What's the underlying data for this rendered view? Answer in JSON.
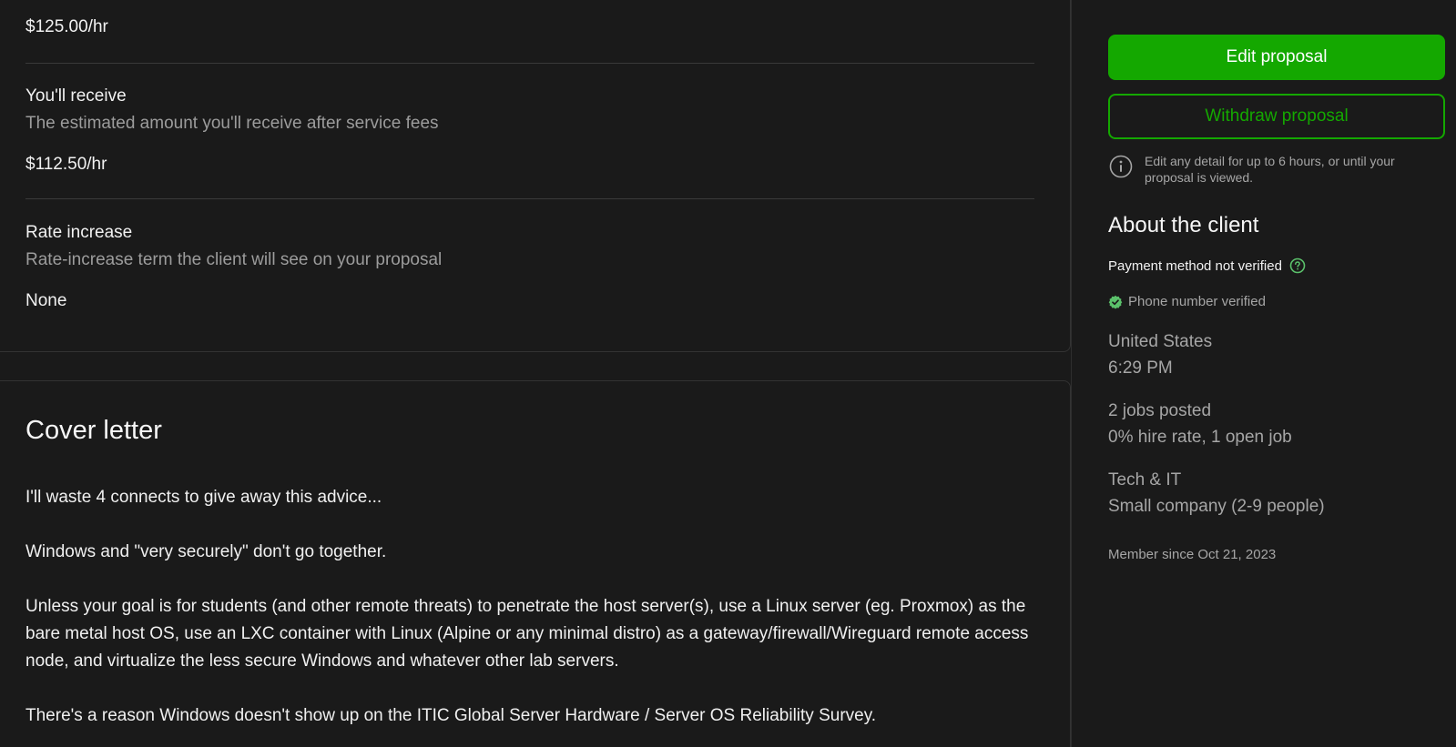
{
  "terms": {
    "bid_rate": "$125.00/hr",
    "receive": {
      "title": "You'll receive",
      "description": "The estimated amount you'll receive after service fees",
      "value": "$112.50/hr"
    },
    "rate_increase": {
      "title": "Rate increase",
      "description": "Rate-increase term the client will see on your proposal",
      "value": "None"
    }
  },
  "cover_letter": {
    "title": "Cover letter",
    "paragraphs": [
      "I'll waste 4 connects to give away this advice...",
      "Windows and \"very securely\" don't go together.",
      "Unless your goal is for students (and other remote threats) to penetrate the host server(s), use a Linux server (eg. Proxmox) as the bare metal host OS, use an LXC container with Linux (Alpine or any minimal distro) as a gateway/firewall/Wireguard remote access node, and virtualize the less secure Windows and whatever other lab servers.",
      "There's a reason Windows doesn't show up on the ITIC Global Server Hardware / Server OS Reliability Survey."
    ]
  },
  "sidebar": {
    "edit_button": "Edit proposal",
    "withdraw_button": "Withdraw proposal",
    "info_icon": "info-circle-icon",
    "info_text": "Edit any detail for up to 6 hours, or until your proposal is viewed.",
    "about_title": "About the client",
    "payment_status": "Payment method not verified",
    "help_icon": "question-circle-icon",
    "phone_status": "Phone number verified",
    "verified_icon": "check-badge-icon",
    "location": "United States",
    "local_time": "6:29 PM",
    "jobs_posted": "2 jobs posted",
    "hire_rate": "0% hire rate, 1 open job",
    "industry": "Tech & IT",
    "company_size": "Small company (2-9 people)",
    "member_since": "Member since Oct 21, 2023"
  },
  "colors": {
    "background": "#1a1a1a",
    "accent_green": "#14a800",
    "verified_green": "#5bc16b",
    "muted_text": "#a6a6a6"
  }
}
